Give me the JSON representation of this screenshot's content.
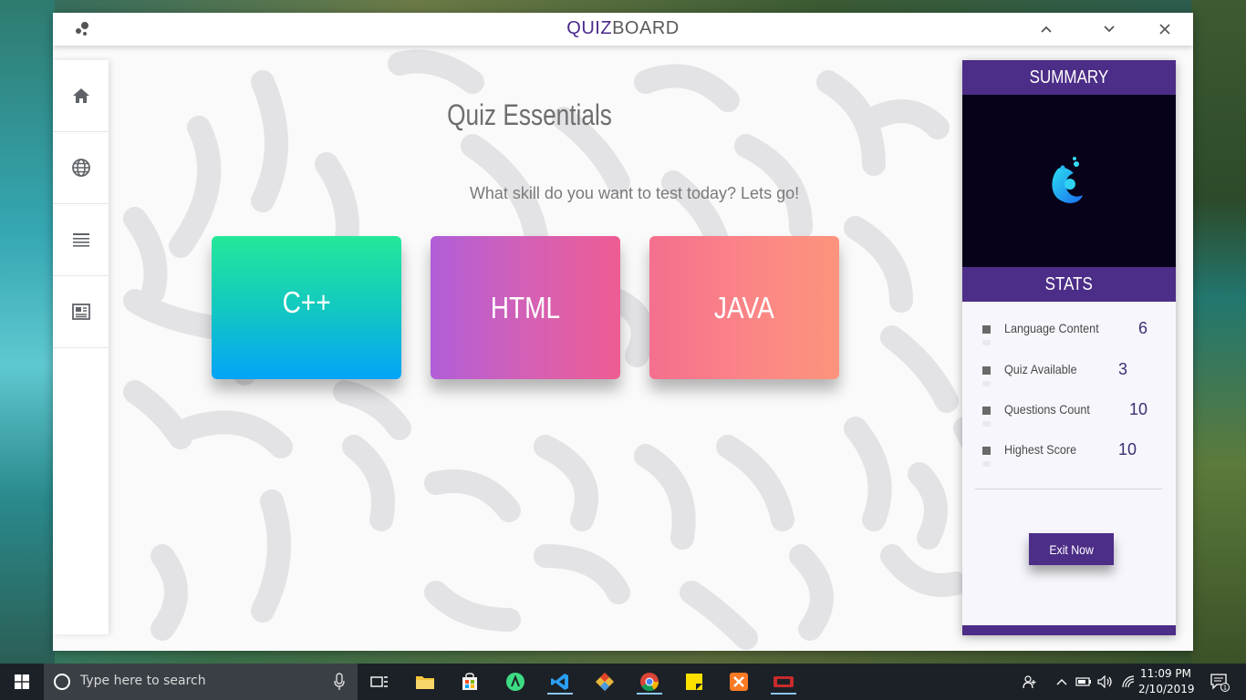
{
  "app": {
    "title_part1": "QUIZ",
    "title_part2": "BOARD",
    "window_controls": [
      "chevron-up-icon",
      "chevron-down-icon",
      "close-icon"
    ]
  },
  "sidebar": {
    "items": [
      {
        "name": "home",
        "icon": "home-icon"
      },
      {
        "name": "globe",
        "icon": "globe-icon"
      },
      {
        "name": "list",
        "icon": "list-icon"
      },
      {
        "name": "news",
        "icon": "newspaper-icon"
      }
    ]
  },
  "main": {
    "title": "Quiz Essentials",
    "subtitle": "What skill do you want to test today? Lets go!",
    "cards": [
      {
        "label": "C++",
        "colors": [
          "#24e89a",
          "#03a4f7"
        ]
      },
      {
        "label": "HTML",
        "colors": [
          "#b15ed9",
          "#ee5c93"
        ]
      },
      {
        "label": "JAVA",
        "colors": [
          "#f46f8e",
          "#fd947b"
        ]
      }
    ]
  },
  "summary": {
    "header": "SUMMARY",
    "stats_header": "STATS",
    "stats": [
      {
        "label": "Language Content",
        "value": "6"
      },
      {
        "label": "Quiz Available",
        "value": "3"
      },
      {
        "label": "Questions Count",
        "value": "10"
      },
      {
        "label": "Highest Score",
        "value": "10"
      }
    ],
    "exit_label": "Exit Now",
    "accent": "#4c2d87"
  },
  "taskbar": {
    "search_placeholder": "Type here to search",
    "time": "11:09 PM",
    "date": "2/10/2019",
    "notification_count": "1",
    "apps": [
      "task-view-icon",
      "file-explorer-icon",
      "store-icon",
      "android-studio-icon",
      "vscode-icon",
      "git-icon",
      "chrome-icon",
      "sticky-notes-icon",
      "xampp-icon",
      "app-icon"
    ]
  }
}
